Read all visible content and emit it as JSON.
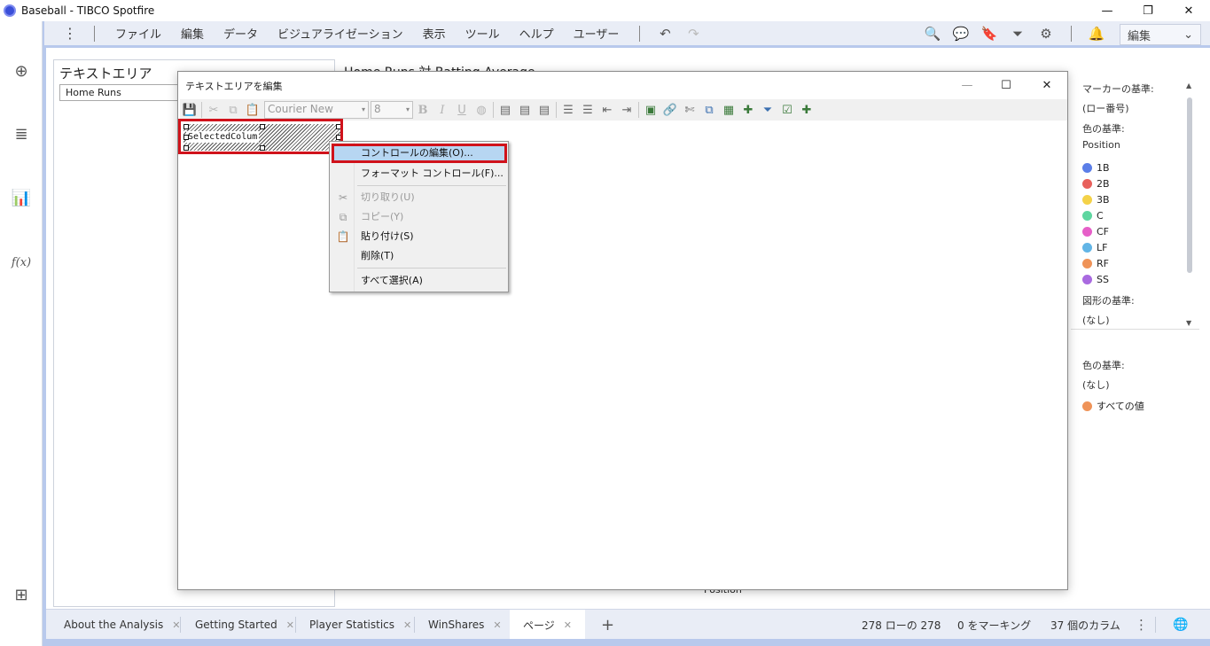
{
  "window": {
    "title": "Baseball - TIBCO Spotfire",
    "minimize": "—",
    "restore": "❐",
    "close": "✕"
  },
  "menubar": {
    "more": "⋮",
    "items": [
      "ファイル",
      "編集",
      "データ",
      "ビジュアライゼーション",
      "表示",
      "ツール",
      "ヘルプ",
      "ユーザー"
    ],
    "undo": "↶",
    "redo": "↷",
    "search": "🔍",
    "comments": "💬",
    "bookmark": "🔖",
    "filter": "⏷",
    "settings": "⚙",
    "notifications": "🔔",
    "mode_dropdown": "編集",
    "mode_caret": "⌄"
  },
  "leftstrip": {
    "add": "⊕",
    "data": "≣",
    "visual": "📊",
    "fx": "f(x)",
    "flow": "⊞"
  },
  "textarea_panel": {
    "title": "テキストエリア",
    "dropdown_value": "Home Runs"
  },
  "chart_panel": {
    "title": "Home Runs 対 Batting Average",
    "xlabel": "Position"
  },
  "legend": {
    "marker_by_label": "マーカーの基準:",
    "marker_by_value": "(ロー番号)",
    "color_by_label": "色の基準:",
    "color_by_value": "Position",
    "items": [
      {
        "label": "1B",
        "color": "#5b7ee8"
      },
      {
        "label": "2B",
        "color": "#e8605c"
      },
      {
        "label": "3B",
        "color": "#f4d248"
      },
      {
        "label": "C",
        "color": "#5ed6a0"
      },
      {
        "label": "CF",
        "color": "#e65fc8"
      },
      {
        "label": "LF",
        "color": "#62b5e6"
      },
      {
        "label": "RF",
        "color": "#ef9358"
      },
      {
        "label": "SS",
        "color": "#a96ae0"
      }
    ],
    "shape_by_label": "図形の基準:",
    "shape_by_value": "(なし)",
    "scroll_up": "▲",
    "scroll_down": "▼"
  },
  "legend2": {
    "color_by_label": "色の基準:",
    "color_by_value": "(なし)",
    "item_label": "すべての値",
    "item_color": "#ef9358"
  },
  "dialog": {
    "title": "テキストエリアを編集",
    "minimize": "—",
    "maximize": "☐",
    "close": "✕",
    "font_name": "Courier New",
    "font_size": "8",
    "combo_caret": "▾",
    "bold": "B",
    "italic": "I",
    "underline": "U",
    "control_text": "SelectedColum"
  },
  "context_menu": {
    "items": [
      {
        "label": "コントロールの編集(O)...",
        "icon": "",
        "disabled": false
      },
      {
        "label": "フォーマット コントロール(F)...",
        "icon": "",
        "disabled": false
      },
      {
        "label": "切り取り(U)",
        "icon": "✂",
        "disabled": true
      },
      {
        "label": "コピー(Y)",
        "icon": "⧉",
        "disabled": true
      },
      {
        "label": "貼り付け(S)",
        "icon": "📋",
        "disabled": false
      },
      {
        "label": "削除(T)",
        "icon": "",
        "disabled": false
      },
      {
        "label": "すべて選択(A)",
        "icon": "",
        "disabled": false
      }
    ]
  },
  "tabs": [
    {
      "label": "About the Analysis",
      "close": "✕"
    },
    {
      "label": "Getting Started",
      "close": "✕"
    },
    {
      "label": "Player Statistics",
      "close": "✕"
    },
    {
      "label": "WinShares",
      "close": "✕"
    },
    {
      "label": "ページ",
      "close": "✕"
    }
  ],
  "add_tab": "+",
  "status": {
    "rows": "278 ローの 278",
    "marked": "0 をマーキング",
    "columns": "37 個のカラム",
    "more": "⋮",
    "globe": "🌐"
  }
}
